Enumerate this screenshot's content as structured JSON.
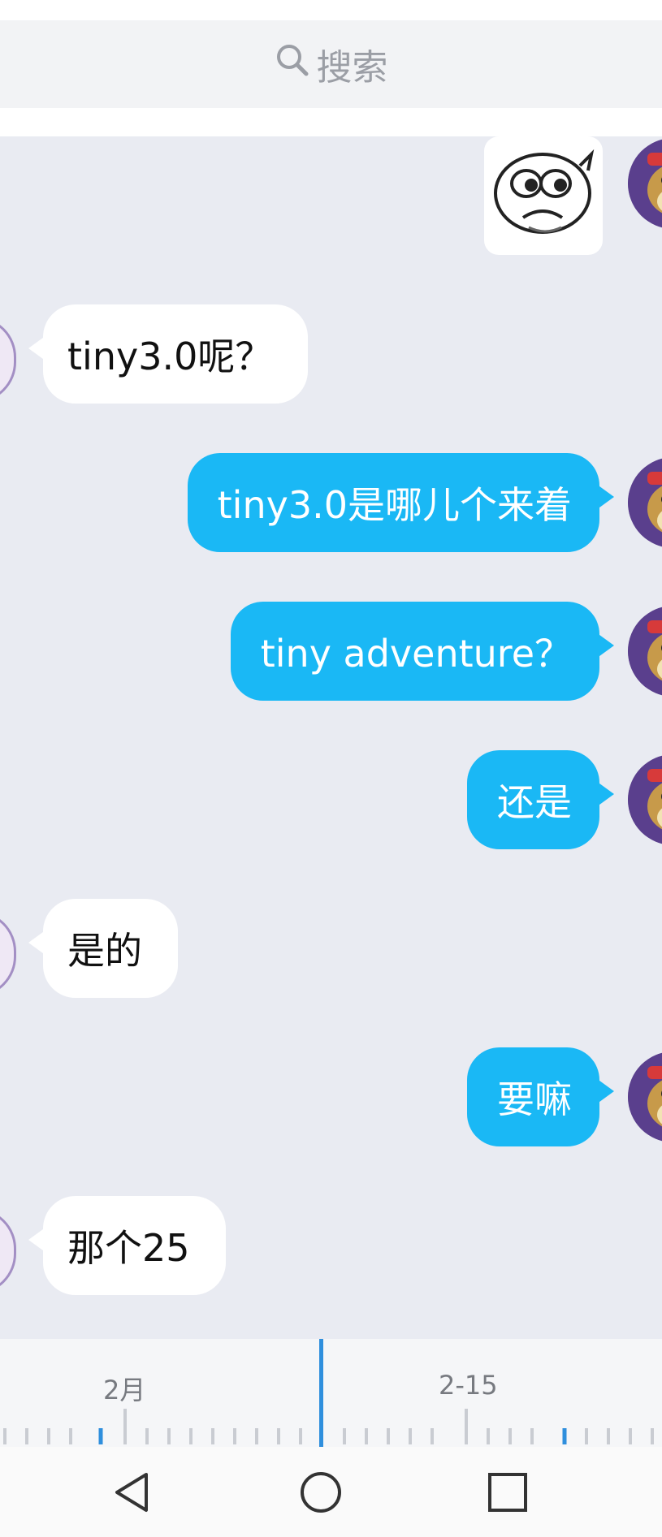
{
  "search": {
    "placeholder": "搜索"
  },
  "messages": [
    {
      "side": "in",
      "text": "tiny3.0呢？"
    },
    {
      "side": "out",
      "text": "tiny3.0是哪儿个来着"
    },
    {
      "side": "out",
      "text": "tiny adventure？"
    },
    {
      "side": "out",
      "text": "还是"
    },
    {
      "side": "in",
      "text": "是的"
    },
    {
      "side": "out",
      "text": "要嘛"
    },
    {
      "side": "in",
      "text": "那个25"
    }
  ],
  "timeline": {
    "labels": [
      "2月",
      "2-15"
    ]
  },
  "colors": {
    "accent": "#1ab8f5",
    "chat_bg": "#e9ebf2",
    "cursor": "#2f8fdd"
  },
  "nav": {
    "icons": [
      "back-triangle-icon",
      "home-circle-icon",
      "recents-square-icon"
    ]
  }
}
